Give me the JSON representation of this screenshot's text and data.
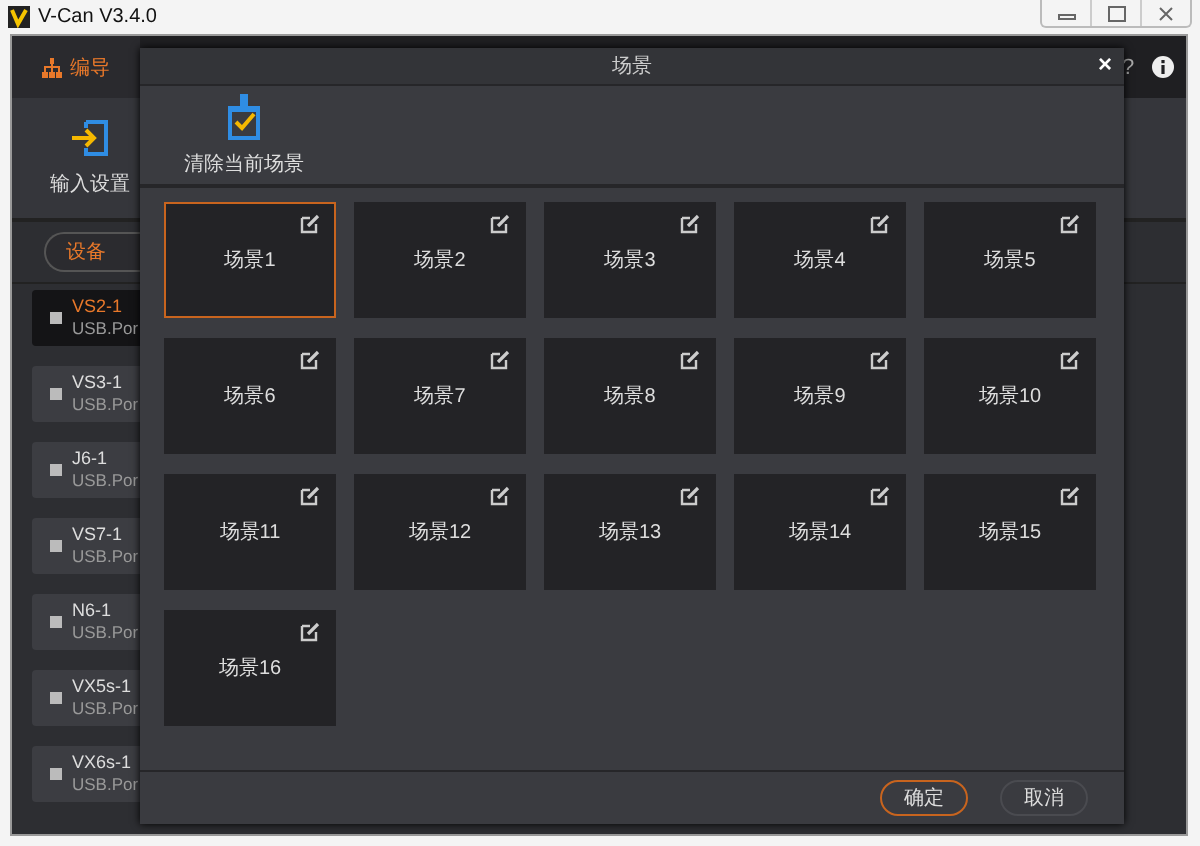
{
  "window": {
    "title": "V-Can V3.4.0"
  },
  "nav": {
    "tab": "编导",
    "help": "?"
  },
  "toolbar": {
    "button": "输入设置"
  },
  "tabs": [
    {
      "label": "设备",
      "selected": true
    }
  ],
  "devices": [
    {
      "name": "VS2-1",
      "port": "USB.Por",
      "selected": true
    },
    {
      "name": "VS3-1",
      "port": "USB.Por",
      "selected": false
    },
    {
      "name": "J6-1",
      "port": "USB.Por",
      "selected": false
    },
    {
      "name": "VS7-1",
      "port": "USB.Por",
      "selected": false
    },
    {
      "name": "N6-1",
      "port": "USB.Por",
      "selected": false
    },
    {
      "name": "VX5s-1",
      "port": "USB.Por",
      "selected": false
    },
    {
      "name": "VX6s-1",
      "port": "USB.Por",
      "selected": false
    }
  ],
  "dialog": {
    "title": "场景",
    "close": "×",
    "clear_button": "清除当前场景",
    "scenes": [
      {
        "label": "场景1",
        "selected": true
      },
      {
        "label": "场景2",
        "selected": false
      },
      {
        "label": "场景3",
        "selected": false
      },
      {
        "label": "场景4",
        "selected": false
      },
      {
        "label": "场景5",
        "selected": false
      },
      {
        "label": "场景6",
        "selected": false
      },
      {
        "label": "场景7",
        "selected": false
      },
      {
        "label": "场景8",
        "selected": false
      },
      {
        "label": "场景9",
        "selected": false
      },
      {
        "label": "场景10",
        "selected": false
      },
      {
        "label": "场景11",
        "selected": false
      },
      {
        "label": "场景12",
        "selected": false
      },
      {
        "label": "场景13",
        "selected": false
      },
      {
        "label": "场景14",
        "selected": false
      },
      {
        "label": "场景15",
        "selected": false
      },
      {
        "label": "场景16",
        "selected": false
      }
    ],
    "buttons": [
      {
        "label": "确定",
        "kind": "primary"
      },
      {
        "label": "取消",
        "kind": "secondary"
      }
    ]
  }
}
